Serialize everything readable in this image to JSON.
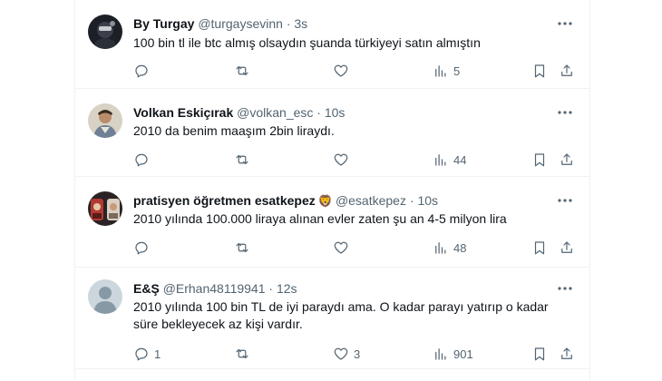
{
  "tweets": [
    {
      "name": "By Turgay",
      "badge": "",
      "handle": "@turgaysevinn",
      "dot": "·",
      "time": "3s",
      "text": "100 bin tl ile btc almış olsaydın şuanda türkiyeyi satın almıştın",
      "replies": "",
      "retweets": "",
      "likes": "",
      "views": "5"
    },
    {
      "name": "Volkan Eskiçırak",
      "badge": "",
      "handle": "@volkan_esc",
      "dot": "·",
      "time": "10s",
      "text": "2010 da benim maaşım 2bin liraydı.",
      "replies": "",
      "retweets": "",
      "likes": "",
      "views": "44"
    },
    {
      "name": "pratisyen öğretmen esatkepez",
      "badge": "🦁",
      "handle": "@esatkepez",
      "dot": "·",
      "time": "10s",
      "text": "2010 yılında 100.000 liraya alınan evler zaten şu an 4-5 milyon lira",
      "replies": "",
      "retweets": "",
      "likes": "",
      "views": "48"
    },
    {
      "name": "E&Ş",
      "badge": "",
      "handle": "@Erhan48119941",
      "dot": "·",
      "time": "12s",
      "text": "2010 yılında 100 bin TL de iyi paraydı ama. O kadar parayı yatırıp o kadar\nsüre bekleyecek az kişi vardır.",
      "replies": "1",
      "retweets": "",
      "likes": "3",
      "views": "901"
    }
  ],
  "icons": {
    "reply": "reply-icon",
    "retweet": "retweet-icon",
    "like": "heart-icon",
    "views": "views-chart-icon",
    "bookmark": "bookmark-icon",
    "share": "share-icon",
    "more": "more-icon"
  },
  "colors": {
    "text": "#0f1419",
    "secondary": "#536471",
    "border": "#eff3f4"
  }
}
